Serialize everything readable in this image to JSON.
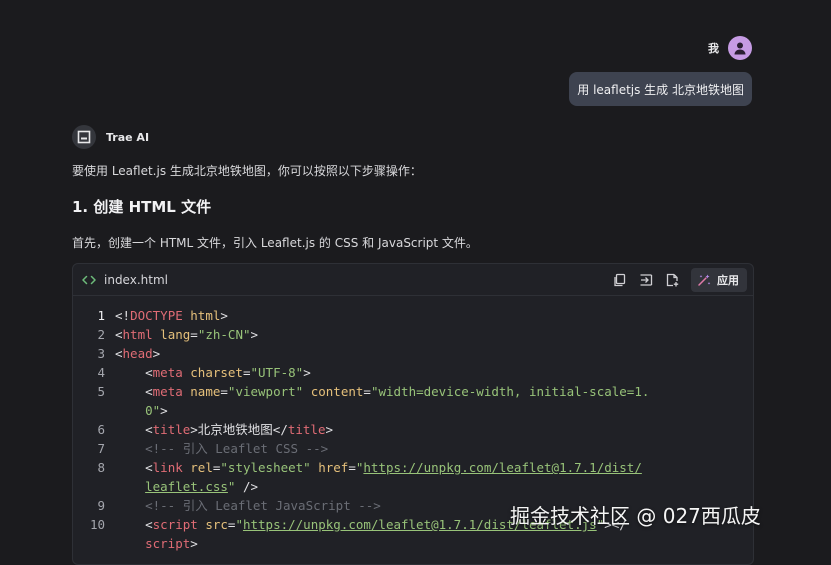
{
  "user": {
    "name": "我",
    "message": "用 leafletjs 生成 北京地铁地图"
  },
  "assistant": {
    "name": "Trae AI",
    "intro": "要使用 Leaflet.js 生成北京地铁地图，你可以按照以下步骤操作：",
    "heading": "1. 创建 HTML 文件",
    "paragraph": "首先，创建一个 HTML 文件，引入 Leaflet.js 的 CSS 和 JavaScript 文件。"
  },
  "code": {
    "language_icon": "code-brackets-icon",
    "filename": "index.html",
    "apply_label": "应用",
    "tools": [
      "copy-icon",
      "insert-icon",
      "new-file-icon"
    ],
    "lines": [
      {
        "n": "1",
        "text": "<!DOCTYPE html>"
      },
      {
        "n": "2",
        "text": "<html lang=\"zh-CN\">"
      },
      {
        "n": "3",
        "text": "<head>"
      },
      {
        "n": "4",
        "text": "    <meta charset=\"UTF-8\">"
      },
      {
        "n": "5",
        "text": "    <meta name=\"viewport\" content=\"width=device-width, initial-scale=1."
      },
      {
        "n": "",
        "text": "    0\">"
      },
      {
        "n": "6",
        "text": "    <title>北京地铁地图</title>"
      },
      {
        "n": "7",
        "text": "    <!-- 引入 Leaflet CSS -->"
      },
      {
        "n": "8",
        "text": "    <link rel=\"stylesheet\" href=\"https://unpkg.com/leaflet@1.7.1/dist/"
      },
      {
        "n": "",
        "text": "    leaflet.css\" />"
      },
      {
        "n": "9",
        "text": "    <!-- 引入 Leaflet JavaScript -->"
      },
      {
        "n": "10",
        "text": "    <script src=\"https://unpkg.com/leaflet@1.7.1/dist/leaflet.js\"></"
      },
      {
        "n": "",
        "text": "    script>"
      }
    ]
  },
  "watermark": "掘金技术社区 @ 027西瓜皮",
  "colors": {
    "background": "#1b1b1e",
    "bubble": "#3e4350",
    "avatar": "#c69be4",
    "code_bg": "#202126"
  }
}
